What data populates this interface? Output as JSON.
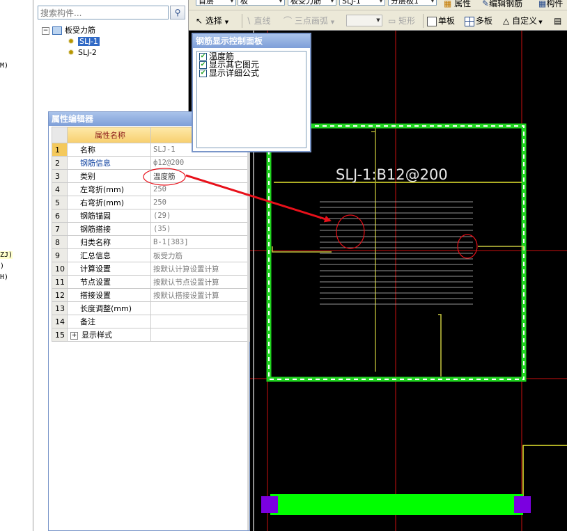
{
  "left_column": {
    "lines": [
      "M)",
      "ZJ)",
      ")",
      "H)"
    ]
  },
  "tree": {
    "search_placeholder": "搜索构件...",
    "root_label": "板受力筋",
    "items": [
      {
        "label": "SLJ-1",
        "selected": true
      },
      {
        "label": "SLJ-2",
        "selected": false
      }
    ]
  },
  "toolbar": {
    "floor_combo": "首层",
    "type_combo": "板",
    "subtype_combo": "板受力筋",
    "element_combo": "SLJ-1",
    "layer_combo": "分层板1",
    "properties_label": "属性",
    "edit_rebar_label": "编辑钢筋",
    "component_label": "构件",
    "select_label": "选择",
    "line_label": "直线",
    "arc_label": "三点画弧",
    "rect_label": "矩形",
    "single_board_label": "单板",
    "multi_board_label": "多板",
    "custom_label": "自定义"
  },
  "property_editor": {
    "title": "属性编辑器",
    "header_name": "属性名称",
    "header_value": "属",
    "rows": [
      {
        "num": "1",
        "name": "名称",
        "value": "SLJ-1",
        "name_blue": false,
        "value_dark": false
      },
      {
        "num": "2",
        "name": "钢筋信息",
        "value": "ф12@200",
        "name_blue": true,
        "value_dark": false
      },
      {
        "num": "3",
        "name": "类别",
        "value": "温度筋",
        "name_blue": false,
        "value_dark": true
      },
      {
        "num": "4",
        "name": "左弯折(mm)",
        "value": "250",
        "name_blue": false,
        "value_dark": false
      },
      {
        "num": "5",
        "name": "右弯折(mm)",
        "value": "250",
        "name_blue": false,
        "value_dark": false
      },
      {
        "num": "6",
        "name": "钢筋锚固",
        "value": "(29)",
        "name_blue": false,
        "value_dark": false
      },
      {
        "num": "7",
        "name": "钢筋搭接",
        "value": "(35)",
        "name_blue": false,
        "value_dark": false
      },
      {
        "num": "8",
        "name": "归类名称",
        "value": "B-1[383]",
        "name_blue": false,
        "value_dark": false
      },
      {
        "num": "9",
        "name": "汇总信息",
        "value": "板受力筋",
        "name_blue": false,
        "value_dark": false
      },
      {
        "num": "10",
        "name": "计算设置",
        "value": "按默认计算设置计算",
        "name_blue": false,
        "value_dark": false
      },
      {
        "num": "11",
        "name": "节点设置",
        "value": "按默认节点设置计算",
        "name_blue": false,
        "value_dark": false
      },
      {
        "num": "12",
        "name": "搭接设置",
        "value": "按默认搭接设置计算",
        "name_blue": false,
        "value_dark": false
      },
      {
        "num": "13",
        "name": "长度调整(mm)",
        "value": "",
        "name_blue": false,
        "value_dark": false
      },
      {
        "num": "14",
        "name": "备注",
        "value": "",
        "name_blue": false,
        "value_dark": false
      },
      {
        "num": "15",
        "name": "显示样式",
        "value": "",
        "name_blue": false,
        "value_dark": false
      }
    ]
  },
  "control_panel": {
    "title": "钢筋显示控制面板",
    "options": [
      {
        "label": "温度筋",
        "checked": true
      },
      {
        "label": "显示其它图元",
        "checked": true
      },
      {
        "label": "显示详细公式",
        "checked": true
      }
    ]
  },
  "canvas": {
    "rebar_label": "SLJ-1:B12@200"
  },
  "colors": {
    "canvas_bg": "#000000",
    "slab_border": "#22dd22",
    "rebar_line": "#e8e830",
    "grid_line": "#cc1111",
    "annotation": "#e8101a",
    "beam_fill": "#00ff00",
    "column_fill": "#7b00e0"
  }
}
